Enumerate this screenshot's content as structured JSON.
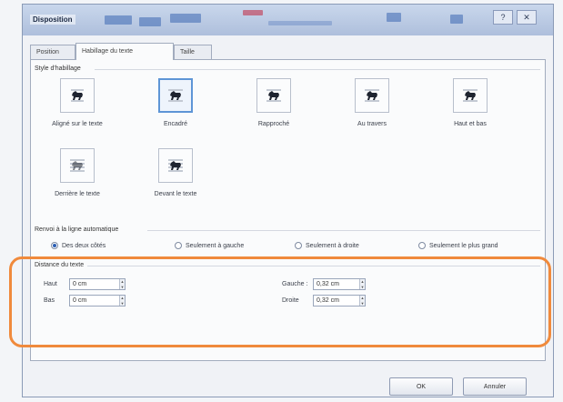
{
  "dialog": {
    "title": "Disposition",
    "min_label": "?",
    "close_label": "✕"
  },
  "tabs": [
    {
      "label": "Position"
    },
    {
      "label": "Habillage du texte"
    },
    {
      "label": "Taille"
    }
  ],
  "wrap_style": {
    "title": "Style d'habillage",
    "items": [
      {
        "label": "Aligné sur le texte"
      },
      {
        "label": "Encadré"
      },
      {
        "label": "Rapproché"
      },
      {
        "label": "Au travers"
      },
      {
        "label": "Haut et bas"
      },
      {
        "label": "Derrière le texte"
      },
      {
        "label": "Devant le texte"
      }
    ],
    "selected_index": 1
  },
  "wrap_text": {
    "title": "Renvoi à la ligne automatique",
    "options": [
      {
        "label": "Des deux côtés"
      },
      {
        "label": "Seulement à gauche"
      },
      {
        "label": "Seulement à droite"
      },
      {
        "label": "Seulement le plus grand"
      }
    ],
    "selected_index": 0
  },
  "distance": {
    "title": "Distance du texte",
    "haut": {
      "label": "Haut",
      "value": "0 cm"
    },
    "bas": {
      "label": "Bas",
      "value": "0 cm"
    },
    "gauche": {
      "label": "Gauche :",
      "value": "0,32 cm"
    },
    "droite": {
      "label": "Droite",
      "value": "0,32 cm"
    }
  },
  "footer": {
    "ok_label": "OK",
    "cancel_label": "Annuler"
  },
  "colors": {
    "highlight": "#f08a3c",
    "selected_border": "#5e95d6"
  }
}
